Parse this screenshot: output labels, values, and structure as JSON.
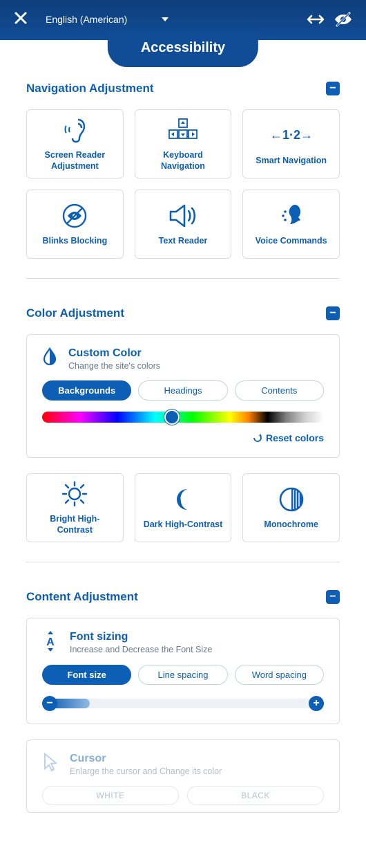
{
  "header": {
    "title": "Accessibility",
    "language_selected": "English (American)"
  },
  "sections": {
    "navigation": {
      "title": "Navigation Adjustment",
      "cards": {
        "screen_reader": "Screen Reader Adjustment",
        "keyboard": "Keyboard Navigation",
        "smart_nav": "Smart Navigation",
        "blinks": "Blinks Blocking",
        "text_reader": "Text Reader",
        "voice": "Voice Commands"
      }
    },
    "color": {
      "title": "Color Adjustment",
      "custom": {
        "title": "Custom Color",
        "subtitle": "Change the site's colors",
        "tabs": {
          "bg": "Backgrounds",
          "headings": "Headings",
          "contents": "Contents"
        },
        "reset": "Reset colors"
      },
      "cards": {
        "bright": "Bright High-Contrast",
        "dark": "Dark High-Contrast",
        "mono": "Monochrome"
      }
    },
    "content": {
      "title": "Content Adjustment",
      "font": {
        "title": "Font sizing",
        "subtitle": "Increase and Decrease the Font Size",
        "tabs": {
          "size": "Font size",
          "line": "Line spacing",
          "word": "Word spacing"
        }
      },
      "cursor": {
        "title": "Cursor",
        "subtitle": "Enlarge the cursor and Change its color",
        "white": "WHITE",
        "black": "BLACK"
      }
    }
  }
}
